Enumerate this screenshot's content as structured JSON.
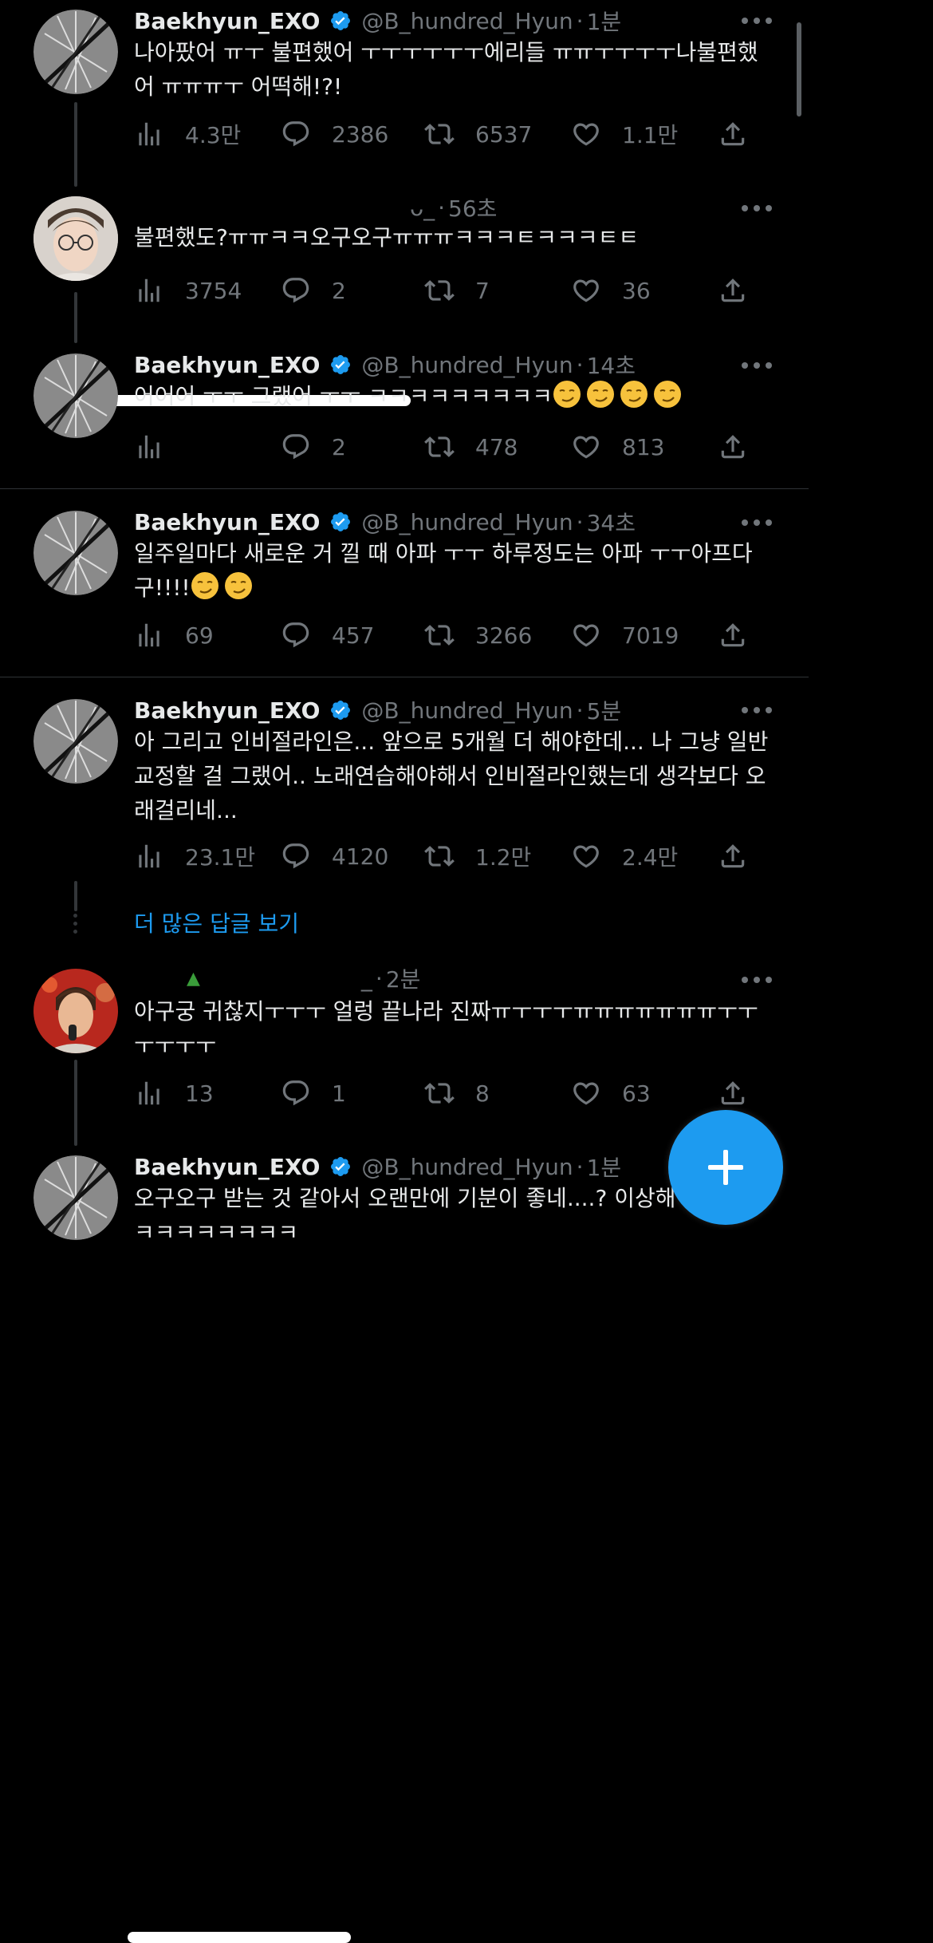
{
  "accent_color": "#1d9bf0",
  "tweets": [
    {
      "name": "Baekhyun_EXO",
      "handle": "@B_hundred_Hyun",
      "time": "1분",
      "text": "나아팠어 ㅠㅜ 불편했어 ㅜㅜㅜㅜㅜㅜ에리들 ㅠㅠㅜㅜㅜㅜ나불편했어 ㅠㅠㅠㅜ 어떡해!?!",
      "views": "4.3만",
      "replies": "2386",
      "retweets": "6537",
      "likes": "1.1만"
    },
    {
      "name": "",
      "handle": "",
      "time": "56초",
      "handle_tail": "ᴗ_",
      "text": "불편했도?ㅠㅠㅋㅋ오구오구ㅠㅠㅠㅋㅋㅋㅌㅋㅋㅋㅌㅌ",
      "views": "3754",
      "replies": "2",
      "retweets": "7",
      "likes": "36"
    },
    {
      "name": "Baekhyun_EXO",
      "handle": "@B_hundred_Hyun",
      "time": "14초",
      "text": "어어어 ㅜㅜ 그랬어 ㅜㅜ ㅋㅋㅋㅋㅋㅋㅋㅋㅋ",
      "views": "",
      "replies": "2",
      "retweets": "478",
      "likes": "813"
    },
    {
      "name": "Baekhyun_EXO",
      "handle": "@B_hundred_Hyun",
      "time": "34초",
      "text": "일주일마다 새로운 거 낄 때 아파 ㅜㅜ 하루정도는 아파 ㅜㅜ아프다구!!!!",
      "views": "69",
      "replies": "457",
      "retweets": "3266",
      "likes": "7019"
    },
    {
      "name": "Baekhyun_EXO",
      "handle": "@B_hundred_Hyun",
      "time": "5분",
      "text": "아 그리고 인비절라인은... 앞으로 5개월 더 해야한데... 나 그냥 일반교정할 걸 그랬어.. 노래연습해야해서 인비절라인했는데 생각보다 오래걸리네...",
      "views": "23.1만",
      "replies": "4120",
      "retweets": "1.2만",
      "likes": "2.4만"
    },
    {
      "name": "",
      "handle": "",
      "time": "2분",
      "handle_tail": "_",
      "text": "아구궁 귀찮지ㅜㅜㅜ 얼렁 끝나라 진짜ㅠㅜㅜㅜㅠㅠㅠㅠㅠㅠㅠㅜㅜㅜㅜㅜㅜ",
      "views": "13",
      "replies": "1",
      "retweets": "8",
      "likes": "63"
    },
    {
      "name": "Baekhyun_EXO",
      "handle": "@B_hundred_Hyun",
      "time": "1분",
      "text": "오구오구 받는 것 같아서 오랜만에 기분이 좋네....? 이상해\nㅋㅋㅋㅋㅋㅋㅋㅋ"
    }
  ],
  "more_replies_label": "더 많은 답글 보기",
  "icons": [
    "views-icon",
    "reply-icon",
    "retweet-icon",
    "like-icon",
    "share-icon",
    "verified-icon",
    "more-icon",
    "compose-icon"
  ]
}
